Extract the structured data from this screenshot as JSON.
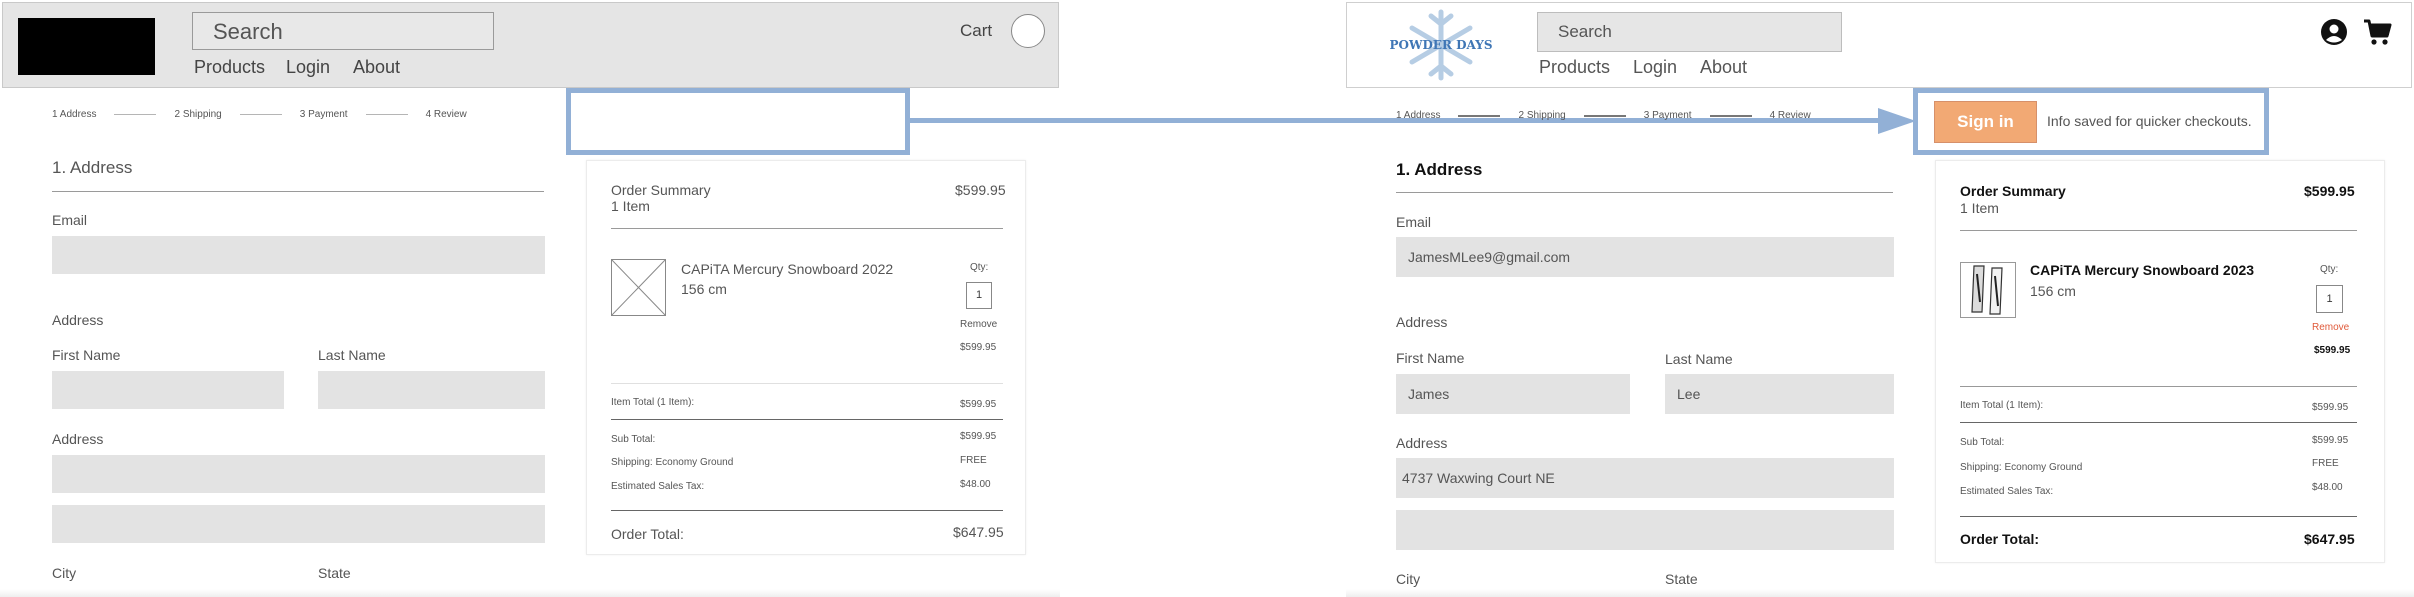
{
  "left": {
    "search_text": "Search",
    "nav": [
      "Products",
      "Login",
      "About"
    ],
    "cart": "Cart",
    "steps": [
      "1 Address",
      "2 Shipping",
      "3 Payment",
      "4 Review"
    ],
    "address_title": "1. Address",
    "email_label": "Email",
    "address_section": "Address",
    "first_name_label": "First Name",
    "last_name_label": "Last Name",
    "address_label": "Address",
    "city_label": "City",
    "state_label": "State",
    "summary": {
      "title": "Order Summary",
      "price": "$599.95",
      "count": "1 Item",
      "product_name": "CAPiTA Mercury Snowboard 2022",
      "size": "156 cm",
      "qty_label": "Qty:",
      "qty": "1",
      "remove": "Remove",
      "line_price": "$599.95",
      "item_total_label": "Item Total (1 Item):",
      "item_total": "$599.95",
      "subtotal_label": "Sub Total:",
      "subtotal": "$599.95",
      "shipping_label": "Shipping: Economy Ground",
      "shipping": "FREE",
      "tax_label": "Estimated Sales Tax:",
      "tax": "$48.00",
      "order_total_label": "Order Total:",
      "order_total": "$647.95"
    }
  },
  "right": {
    "logo_text": "POWDER DAYS",
    "search_placeholder": "Search",
    "nav": [
      "Products",
      "Login",
      "About"
    ],
    "steps": [
      "1 Address",
      "2 Shipping",
      "3 Payment",
      "4 Review"
    ],
    "signin_button": "Sign in",
    "signin_note": "Info saved for quicker checkouts.",
    "address_title": "1. Address",
    "email_label": "Email",
    "email_value": "JamesMLee9@gmail.com",
    "address_section": "Address",
    "first_name_label": "First Name",
    "first_name_value": "James",
    "last_name_label": "Last Name",
    "last_name_value": "Lee",
    "address_label": "Address",
    "address_value": "4737 Waxwing Court NE",
    "city_label": "City",
    "state_label": "State",
    "summary": {
      "title": "Order Summary",
      "price": "$599.95",
      "count": "1 Item",
      "product_name": "CAPiTA Mercury Snowboard 2023",
      "size": "156 cm",
      "qty_label": "Qty:",
      "qty": "1",
      "remove": "Remove",
      "line_price": "$599.95",
      "item_total_label": "Item Total (1 Item):",
      "item_total": "$599.95",
      "subtotal_label": "Sub Total:",
      "subtotal": "$599.95",
      "shipping_label": "Shipping: Economy Ground",
      "shipping": "FREE",
      "tax_label": "Estimated Sales Tax:",
      "tax": "$48.00",
      "order_total_label": "Order Total:",
      "order_total": "$647.95"
    }
  },
  "colors": {
    "callout_blue": "#92b0d6",
    "signin_orange": "#f2a974",
    "remove_red": "#e05a3a"
  }
}
